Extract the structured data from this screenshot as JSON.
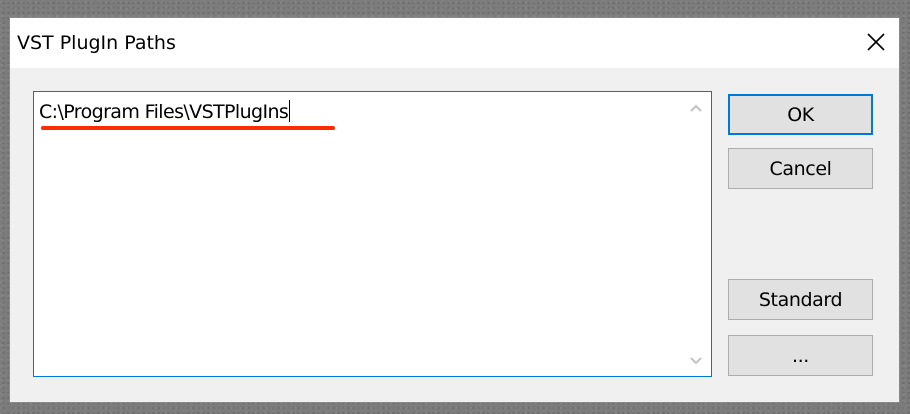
{
  "window": {
    "title": "VST PlugIn Paths",
    "close_icon": "close-icon"
  },
  "editor": {
    "path_text": "C:\\Program Files\\VSTPlugIns",
    "annotation_color": "#ff2a00"
  },
  "buttons": {
    "ok": "OK",
    "cancel": "Cancel",
    "standard": "Standard",
    "browse": "..."
  },
  "colors": {
    "accent": "#0078d7",
    "dialog_bg": "#f0f0f0",
    "button_bg": "#e1e1e1"
  }
}
